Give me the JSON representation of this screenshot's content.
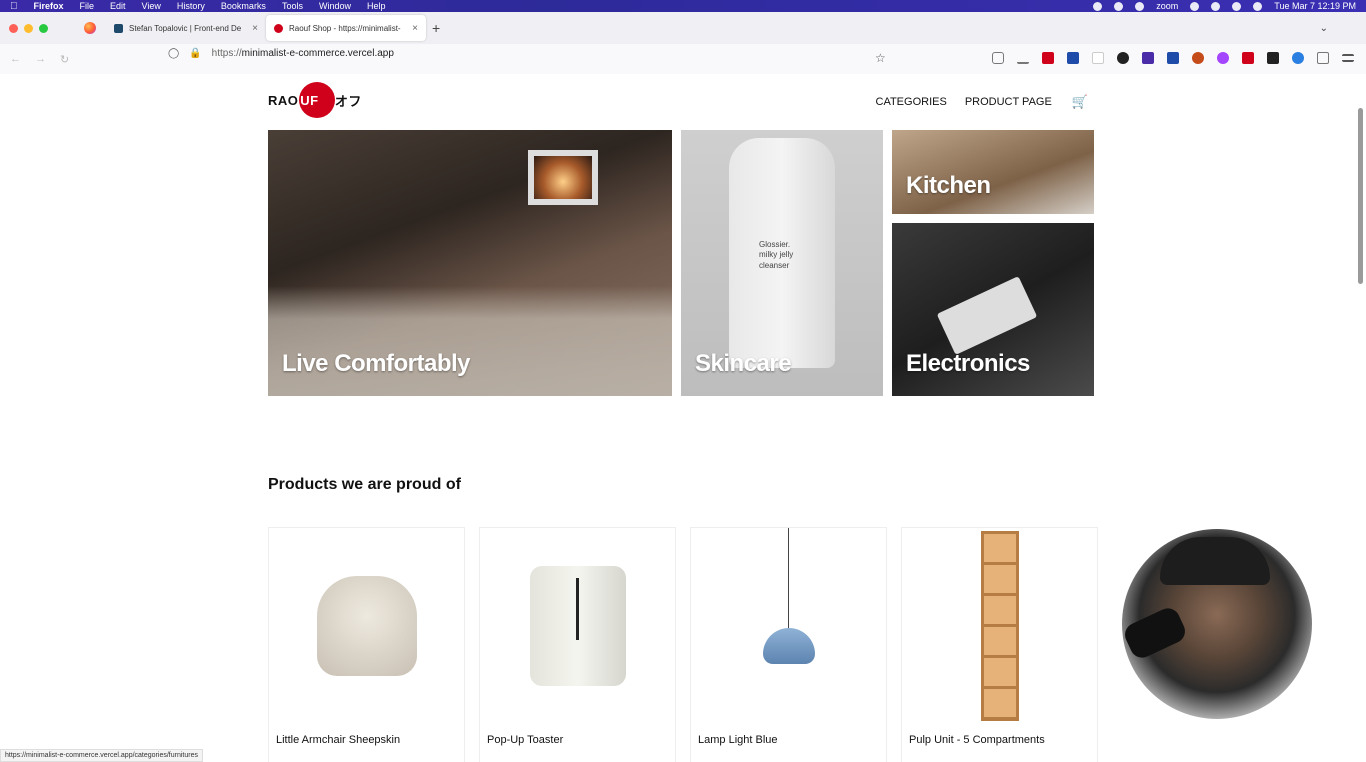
{
  "menubar": {
    "app": "Firefox",
    "items": [
      "File",
      "Edit",
      "View",
      "History",
      "Bookmarks",
      "Tools",
      "Window",
      "Help"
    ],
    "zoom_label": "zoom",
    "datetime": "Tue Mar 7  12:19 PM"
  },
  "tabs": [
    {
      "title": "Stefan Topalovic | Front-end De",
      "favicon_color": "#1d4a6b"
    },
    {
      "title": "Raouf Shop - https://minimalist-",
      "favicon_color": "#d0021b"
    }
  ],
  "address_bar": {
    "scheme": "https://",
    "host": "minimalist-e-commerce.vercel.app"
  },
  "site": {
    "logo_left": "RAO",
    "logo_circle": "UF",
    "logo_right": "ラオフ",
    "nav": [
      "CATEGORIES",
      "PRODUCT PAGE"
    ],
    "categories": [
      "Live Comfortably",
      "Skincare",
      "Kitchen",
      "Electronics"
    ],
    "skincare_bottle_text": "Glossier.\nmilky jelly\ncleanser",
    "section_title": "Products we are proud of",
    "products": [
      {
        "name": "Little Armchair Sheepskin"
      },
      {
        "name": "Pop-Up Toaster"
      },
      {
        "name": "Lamp Light Blue"
      },
      {
        "name": "Pulp Unit - 5 Compartments"
      }
    ]
  },
  "status_bar": "https://minimalist-e-commerce.vercel.app/categories/furnitures",
  "colors": {
    "brand_red": "#d0021b",
    "menubar_bg": "#3a2aa8"
  }
}
